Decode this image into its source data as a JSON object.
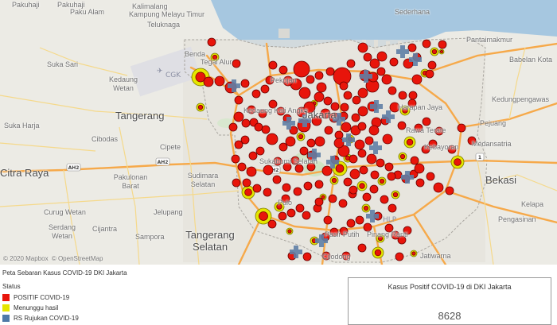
{
  "map": {
    "places": [
      {
        "name": "Pakuhaji",
        "key": "pakuhaji"
      },
      {
        "name": "Pakuhaji",
        "key": "pakuhaji2"
      },
      {
        "name": "Paku Alam",
        "key": "paku-alam"
      },
      {
        "name": "Kalimalang",
        "key": "kalimalang"
      },
      {
        "name": "Kampung Melayu Timur",
        "key": "kampung-melayu-timur"
      },
      {
        "name": "Teluknaga",
        "key": "teluknaga"
      },
      {
        "name": "Suka Sari",
        "key": "suka-sari"
      },
      {
        "name": "Kedaung Wetan",
        "key": "kedaung-wetan"
      },
      {
        "name": "Tangerang",
        "key": "tangerang"
      },
      {
        "name": "Suka Harja",
        "key": "suka-harja"
      },
      {
        "name": "Cibodas",
        "key": "cibodas"
      },
      {
        "name": "Cipete",
        "key": "cipete"
      },
      {
        "name": "Citra Raya",
        "key": "citra-raya"
      },
      {
        "name": "Pakulonan Barat",
        "key": "pakulonan-barat"
      },
      {
        "name": "Sudimara Selatan",
        "key": "sudimara-selatan"
      },
      {
        "name": "Curug Wetan",
        "key": "curug-wetan"
      },
      {
        "name": "Jelupang",
        "key": "jelupang"
      },
      {
        "name": "Serdang Wetan",
        "key": "serdang-wetan"
      },
      {
        "name": "Cijantra",
        "key": "cijantra"
      },
      {
        "name": "Tangerang Selatan",
        "key": "tangerang-selatan"
      },
      {
        "name": "Sampora",
        "key": "sampora"
      },
      {
        "name": "Benda",
        "key": "benda"
      },
      {
        "name": "Tegal Alur",
        "key": "tegal-alur"
      },
      {
        "name": "Pekojan",
        "key": "pekojan"
      },
      {
        "name": "Kedaung Kali Angke",
        "key": "kedaung"
      },
      {
        "name": "Jakarta",
        "key": "jakarta"
      },
      {
        "name": "Sukabumi Selatan",
        "key": "sukabumi-selatan"
      },
      {
        "name": "Pulo",
        "key": "pulo"
      },
      {
        "name": "Pasir Putih",
        "key": "pasir-putih"
      },
      {
        "name": "Pinang Ranti",
        "key": "pinang-ranti"
      },
      {
        "name": "Cilodong",
        "key": "cilodong"
      },
      {
        "name": "Jatiwarna",
        "key": "jatiwarna"
      },
      {
        "name": "Rawa Terate",
        "key": "rawa-terate"
      },
      {
        "name": "Harapan Jaya",
        "key": "harapan-jaya"
      },
      {
        "name": "Kebayoran",
        "key": "kebayoran"
      },
      {
        "name": "Medansatria",
        "key": "medansatria"
      },
      {
        "name": "Pejuang",
        "key": "pejuang"
      },
      {
        "name": "Kedungpengawas",
        "key": "kedungpengawas"
      },
      {
        "name": "Babelan Kota",
        "key": "babelan-kota"
      },
      {
        "name": "Pantaimakmur",
        "key": "pantaimakmur"
      },
      {
        "name": "Sederhana",
        "key": "sederhana"
      },
      {
        "name": "Bekasi",
        "key": "bekasi"
      },
      {
        "name": "Pengasinan",
        "key": "pengasinan"
      },
      {
        "name": "Kelapa",
        "key": "kelapa"
      }
    ],
    "airport_code": "CGK",
    "hlp_code": "HLP",
    "road_shields": [
      "AH2",
      "AH2",
      "AH2",
      "1"
    ],
    "attribution_1": "© 2020 Mapbox",
    "attribution_2": "© OpenStreetMap"
  },
  "caption": "Peta Sebaran Kasus COVID-19 DKI Jakarta",
  "legend": {
    "title": "Status",
    "items": [
      {
        "label": "POSITIF COVID-19",
        "color": "#e8150b"
      },
      {
        "label": "Menunggu hasil",
        "color": "#e5e500"
      },
      {
        "label": "RS Rujukan COVID-19",
        "color": "#4e79a7"
      }
    ]
  },
  "kpi": {
    "title": "Kasus Positif COVID-19 di DKI Jakarta",
    "value": "8628"
  },
  "colors": {
    "positive": "#e8150b",
    "waiting": "#e5e500",
    "hospital": "#5f7ea5",
    "sea": "#a6c7e0",
    "road": "#f6a94a"
  }
}
